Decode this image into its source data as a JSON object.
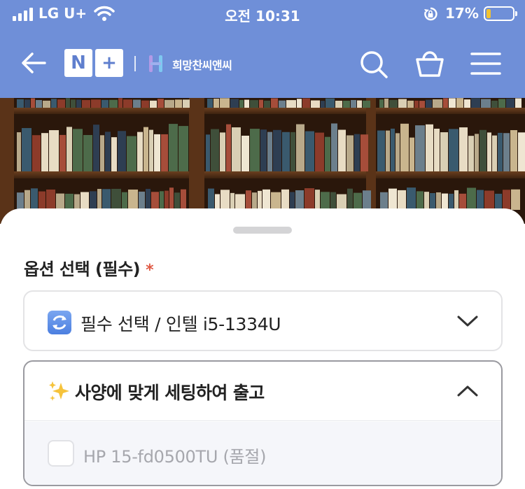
{
  "status_bar": {
    "carrier": "LG U+",
    "time": "오전 10:31",
    "battery_percent": "17%",
    "battery_level": 0.17
  },
  "header": {
    "brand_mark": "N+",
    "brand_name": "희망찬씨앤씨",
    "icons": [
      "back-arrow-icon",
      "search-icon",
      "shopping-basket-icon",
      "hamburger-menu-icon"
    ]
  },
  "sheet": {
    "option_title": "옵션 선택 (필수)",
    "required_marker": "*",
    "select": {
      "icon": "swap-arrows-icon",
      "value": "필수 선택 / 인텔 i5-1334U"
    },
    "group": {
      "icon": "sparkles-icon",
      "title": "사양에 맞게 세팅하여 출고",
      "options": [
        {
          "label": "HP 15-fd0500TU (품절)",
          "checked": false
        }
      ]
    }
  },
  "colors": {
    "header_bg": "#6f8fd8",
    "required": "#e05a45",
    "disabled_text": "#a6a7ad"
  }
}
